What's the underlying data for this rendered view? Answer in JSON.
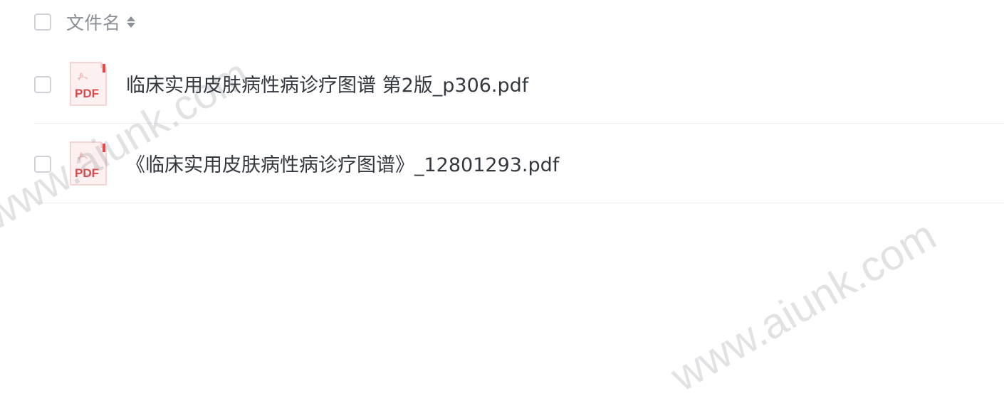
{
  "header": {
    "column_label": "文件名"
  },
  "files": [
    {
      "name": "临床实用皮肤病性病诊疗图谱 第2版_p306.pdf",
      "icon_text": "PDF",
      "icon": "pdf-file-icon"
    },
    {
      "name": "《临床实用皮肤病性病诊疗图谱》_12801293.pdf",
      "icon_text": "PDF",
      "icon": "pdf-file-icon"
    }
  ],
  "watermark": {
    "text": "www.aiunk.com"
  },
  "colors": {
    "pdf_red": "#e24a4a",
    "text": "#33383f",
    "muted": "#8b8f96",
    "divider": "#edeef0"
  }
}
